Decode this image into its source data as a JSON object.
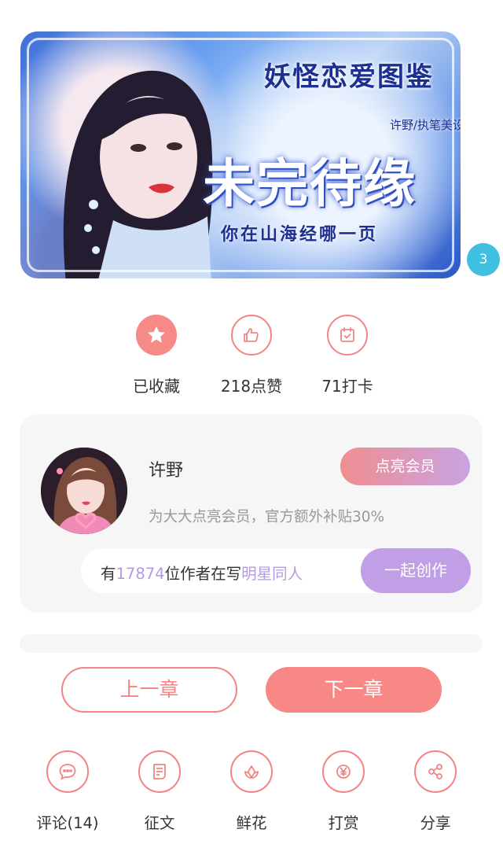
{
  "banner": {
    "top_title": "妖怪恋爱图鉴",
    "main_title": "未完待缘",
    "author_line": "许野/执笔美设",
    "subtitle": "你在山海经哪一页"
  },
  "page_badge": "3",
  "stats": [
    {
      "label": "已收藏",
      "icon": "star-icon",
      "filled": true
    },
    {
      "label": "218点赞",
      "icon": "thumbs-up-icon",
      "filled": false
    },
    {
      "label": "71打卡",
      "icon": "calendar-check-icon",
      "filled": false
    }
  ],
  "author_card": {
    "name": "许野",
    "vip_button": "点亮会员",
    "vip_tip": "为大大点亮会员，官方额外补贴30%",
    "writers_prefix": "有",
    "writers_count": "17874",
    "writers_middle": "位作者在写",
    "writers_topic": "明星同人",
    "create_button": "一起创作"
  },
  "nav": {
    "prev": "上一章",
    "next": "下一章"
  },
  "actions": [
    {
      "label": "评论(14)",
      "icon": "comment-icon"
    },
    {
      "label": "征文",
      "icon": "contest-icon"
    },
    {
      "label": "鲜花",
      "icon": "flower-icon"
    },
    {
      "label": "打赏",
      "icon": "yen-coin-icon"
    },
    {
      "label": "分享",
      "icon": "share-icon"
    }
  ],
  "colors": {
    "accent": "#f28584",
    "purple": "#c09fe6",
    "badge": "#3fc0e0"
  }
}
